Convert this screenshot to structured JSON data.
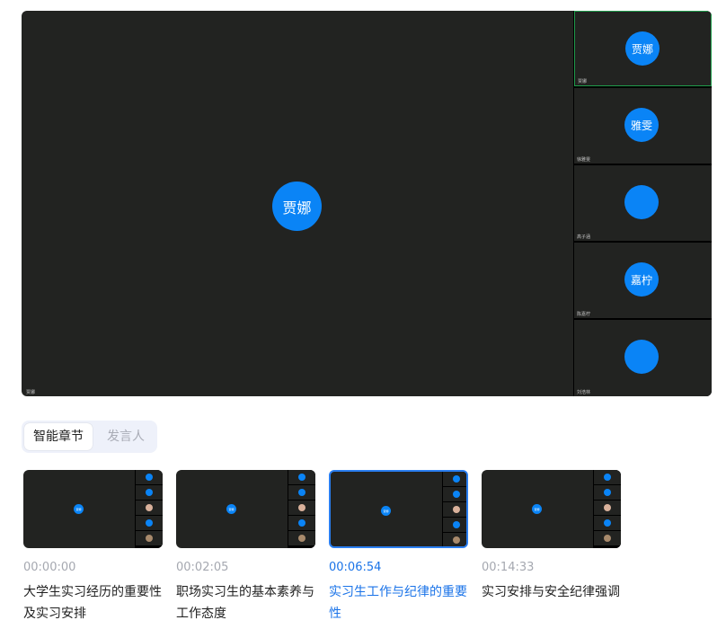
{
  "stage": {
    "main": {
      "avatar_text": "贾娜",
      "name": "贾娜"
    },
    "participants": [
      {
        "avatar_text": "贾娜",
        "name": "贾娜",
        "type": "text",
        "active": true
      },
      {
        "avatar_text": "雅雯",
        "name": "徐雅雯",
        "type": "text",
        "active": false
      },
      {
        "avatar_text": "",
        "name": "高子涵",
        "type": "photo-girl",
        "active": false
      },
      {
        "avatar_text": "嘉柠",
        "name": "陈嘉柠",
        "type": "text",
        "active": false
      },
      {
        "avatar_text": "",
        "name": "刘浩林",
        "type": "photo-dog",
        "active": false
      }
    ]
  },
  "tabs": [
    {
      "label": "智能章节",
      "selected": true
    },
    {
      "label": "发言人",
      "selected": false
    }
  ],
  "chapters": [
    {
      "time": "00:00:00",
      "title": "大学生实习经历的重要性及实习安排",
      "selected": false,
      "thumb_avatar": "贾娜"
    },
    {
      "time": "00:02:05",
      "title": "职场实习生的基本素养与工作态度",
      "selected": false,
      "thumb_avatar": "贾娜"
    },
    {
      "time": "00:06:54",
      "title": "实习生工作与纪律的重要性",
      "selected": true,
      "thumb_avatar": "贾娜"
    },
    {
      "time": "00:14:33",
      "title": "实习安排与安全纪律强调",
      "selected": false,
      "thumb_avatar": "贾娜"
    }
  ],
  "colors": {
    "accent": "#1a73e8",
    "avatar": "#0a84f6",
    "video_bg": "#222321",
    "active_border": "#1f9a4a"
  }
}
